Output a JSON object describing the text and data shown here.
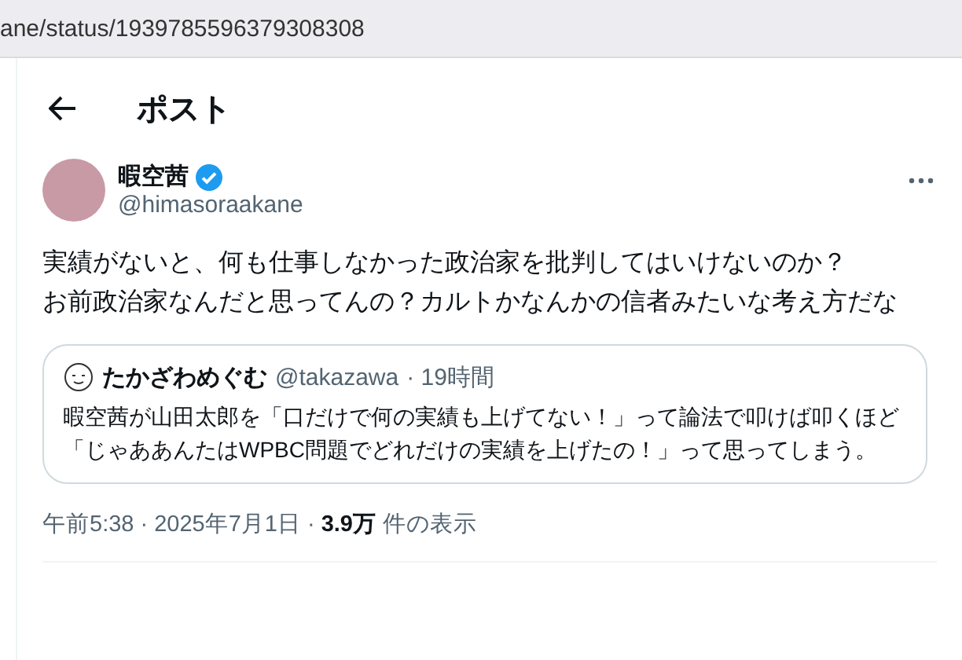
{
  "address_bar": {
    "url": "ane/status/1939785596379308308"
  },
  "header": {
    "title": "ポスト"
  },
  "post": {
    "author": {
      "name": "暇空茜",
      "verified": true,
      "handle": "@himasoraakane"
    },
    "text_lines": [
      "実績がないと、何も仕事しなかった政治家を批判してはいけないのか？",
      "お前政治家なんだと思ってんの？カルトかなんかの信者みたいな考え方だな"
    ],
    "quote": {
      "name": "たかざわめぐむ",
      "handle": "@takazawa",
      "time": "· 19時間",
      "text": "暇空茜が山田太郎を「口だけで何の実績も上げてない！」って論法で叩けば叩くほど「じゃああんたはWPBC問題でどれだけの実績を上げたの！」って思ってしまう。"
    },
    "meta": {
      "time": "午前5:38",
      "separator_1": "·",
      "date": "2025年7月1日",
      "separator_2": "·",
      "views_count": "3.9万",
      "views_label": "件の表示"
    }
  }
}
